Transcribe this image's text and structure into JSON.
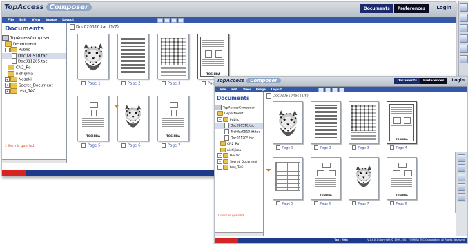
{
  "app": {
    "brand": "TopAccess",
    "product": "Composer",
    "tabs": [
      "Documents",
      "Preferences"
    ],
    "login": "Login"
  },
  "menu": [
    "File",
    "Edit",
    "View",
    "Image",
    "Layout"
  ],
  "sidebar": {
    "title": "Documents"
  },
  "window1": {
    "doc_title": "Doc020510.tac (1/7)",
    "tree": [
      {
        "label": "TopAccessComposer",
        "kind": "root",
        "indent": 0,
        "toggle": ""
      },
      {
        "label": "Department",
        "kind": "folder",
        "indent": 1,
        "toggle": ""
      },
      {
        "label": "Public",
        "kind": "folder",
        "indent": 1,
        "toggle": "−"
      },
      {
        "label": "Doc020510.tac",
        "kind": "file",
        "indent": 3,
        "toggle": "",
        "selected": true
      },
      {
        "label": "Doc011205.tac",
        "kind": "file",
        "indent": 3,
        "toggle": ""
      },
      {
        "label": "CN2_Ro",
        "kind": "folder",
        "indent": 2,
        "toggle": ""
      },
      {
        "label": "nishijima",
        "kind": "folder",
        "indent": 2,
        "toggle": ""
      },
      {
        "label": "Nosaki",
        "kind": "folder",
        "indent": 1,
        "toggle": "+"
      },
      {
        "label": "Secret_Document",
        "kind": "folder",
        "indent": 1,
        "toggle": "+"
      },
      {
        "label": "test_TAC",
        "kind": "folder",
        "indent": 1,
        "toggle": "+"
      }
    ],
    "pages": [
      {
        "label": "Page 1",
        "content": "leopard"
      },
      {
        "label": "Page 2",
        "content": "dense"
      },
      {
        "label": "Page 3",
        "content": "grid"
      },
      {
        "label": "Page 4",
        "content": "form-selected"
      },
      {
        "label": "Page 5",
        "content": "doc-logo"
      },
      {
        "label": "Page 6",
        "content": "leopard2"
      },
      {
        "label": "Page 7",
        "content": "doc-logo"
      }
    ],
    "status": "1 item is queried.",
    "footer_link": "Top | Help",
    "copyright": "V.1.4.0.1 Copyright © 1999-2001 TOSHIBA TEC Co"
  },
  "window2": {
    "doc_title": "Doc020510.tac (1/8)",
    "tree": [
      {
        "label": "TopAccessComposer",
        "kind": "root",
        "indent": 0,
        "toggle": ""
      },
      {
        "label": "Department",
        "kind": "folder",
        "indent": 1,
        "toggle": ""
      },
      {
        "label": "Public",
        "kind": "folder",
        "indent": 1,
        "toggle": "−"
      },
      {
        "label": "Doc020510.tac",
        "kind": "file",
        "indent": 3,
        "toggle": "",
        "selected": true
      },
      {
        "label": "Toshiba0510.itt.tac",
        "kind": "file",
        "indent": 3,
        "toggle": ""
      },
      {
        "label": "Doc011205.tac",
        "kind": "file",
        "indent": 3,
        "toggle": ""
      },
      {
        "label": "CN2_Ro",
        "kind": "folder",
        "indent": 2,
        "toggle": ""
      },
      {
        "label": "nishijima",
        "kind": "folder",
        "indent": 2,
        "toggle": ""
      },
      {
        "label": "Nosaki",
        "kind": "folder",
        "indent": 1,
        "toggle": "+"
      },
      {
        "label": "Secret_Document",
        "kind": "folder",
        "indent": 1,
        "toggle": "+"
      },
      {
        "label": "test_TAC",
        "kind": "folder",
        "indent": 1,
        "toggle": "+"
      }
    ],
    "pages": [
      {
        "label": "Page 1",
        "content": "leopard"
      },
      {
        "label": "Page 2",
        "content": "dense"
      },
      {
        "label": "Page 3",
        "content": "grid"
      },
      {
        "label": "Page 4",
        "content": "form-selected"
      },
      {
        "label": "Page 5",
        "content": "table"
      },
      {
        "label": "Page 6",
        "content": "doc-logo"
      },
      {
        "label": "Page 7",
        "content": "leopard2"
      },
      {
        "label": "Page 8",
        "content": "doc-logo"
      }
    ],
    "status": "1 item is queried.",
    "footer_link": "Top | Help",
    "copyright": "V.1.4.0.1 Copyright © 1999-2001 TOSHIBA TEC Corporation. All Rights Reserved."
  },
  "thumb_logo_text": "TOSHIBA",
  "colors": {
    "accent": "#1a2a6c",
    "menubar": "#3558a8",
    "footer": "#1e3a8a",
    "status": "#e04a1e",
    "arrow": "#e07b17"
  }
}
